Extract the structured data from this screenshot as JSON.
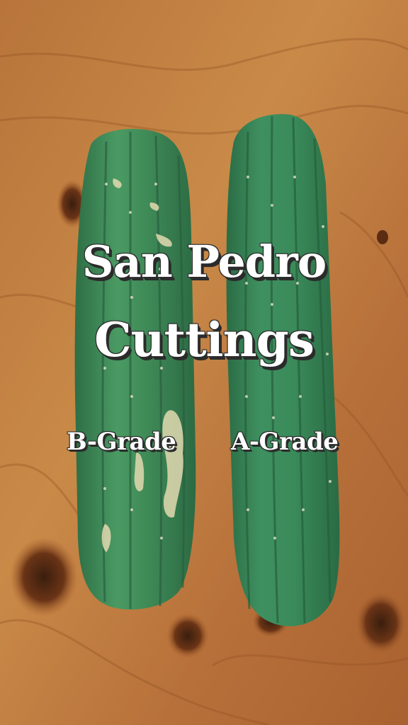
{
  "overlay": {
    "title_line1": "San Pedro",
    "title_line2": "Cuttings",
    "left_label": "B-Grade",
    "right_label": "A-Grade"
  },
  "colors": {
    "wood": "#c07a3c",
    "cactus": "#3f8a57",
    "text": "#ffffff",
    "text_shadow": "#2b2b2b"
  }
}
